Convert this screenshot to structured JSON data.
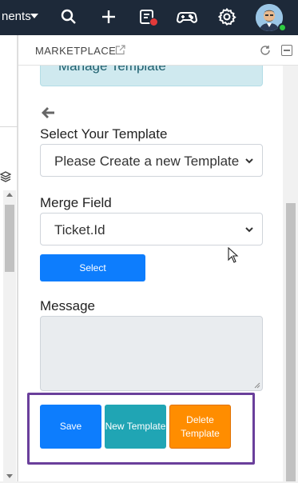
{
  "topbar": {
    "nav_text": "nents",
    "icons": [
      "caret-down-icon",
      "search-icon",
      "plus-icon",
      "tasks-icon",
      "gamepad-icon",
      "gear-icon",
      "avatar"
    ]
  },
  "panel": {
    "title": "MARKETPLACE",
    "info_text": "Manage Template"
  },
  "form": {
    "template_label": "Select Your Template",
    "template_value": "Please Create a new Template",
    "merge_label": "Merge Field",
    "merge_value": "Ticket.Id",
    "select_button": "Select",
    "message_label": "Message",
    "message_value": ""
  },
  "actions": {
    "save": "Save",
    "new_template": "New Template",
    "delete_template": "Delete Template"
  },
  "colors": {
    "primary": "#0d7dfd",
    "info": "#20a5b4",
    "warning": "#ff8d00",
    "highlight": "#6a3f9b",
    "topbar": "#1d2939"
  }
}
